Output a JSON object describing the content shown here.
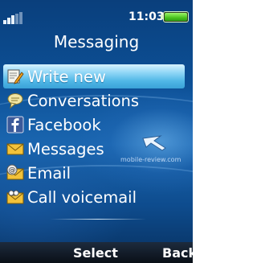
{
  "status_bar": {
    "time": "11:03",
    "signal_icon": "signal-bars-icon",
    "battery_icon": "battery-icon",
    "battery_level": 1.0
  },
  "header": {
    "title": "Messaging"
  },
  "menu": {
    "selected_index": 0,
    "items": [
      {
        "label": "Write new",
        "icon": "pencil-note-icon"
      },
      {
        "label": "Conversations",
        "icon": "speech-bubble-icon"
      },
      {
        "label": "Facebook",
        "icon": "facebook-icon"
      },
      {
        "label": "Messages",
        "icon": "envelope-icon"
      },
      {
        "label": "Email",
        "icon": "email-at-icon"
      },
      {
        "label": "Call voicemail",
        "icon": "voicemail-icon"
      }
    ]
  },
  "watermark": "mobile-review.com",
  "softkeys": {
    "left": "Select",
    "right": "Back"
  },
  "colors": {
    "selection": "#4fb6e6",
    "background": "#0c4f95",
    "softbar": "#0a0f17"
  }
}
